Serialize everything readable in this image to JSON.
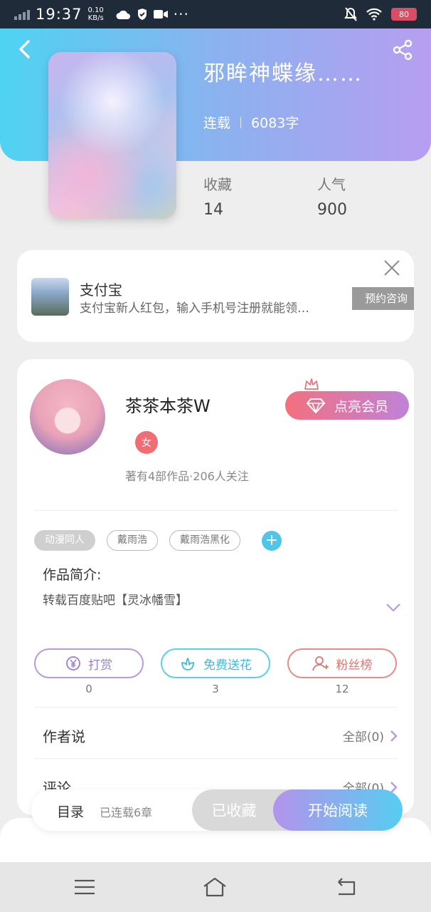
{
  "status_bar": {
    "time": "19:37",
    "net_speed_value": "0.10",
    "net_speed_unit": "KB/s",
    "more": "···",
    "battery": "80"
  },
  "header": {
    "title": "邪眸神蝶缘……",
    "status": "连载",
    "word_count": "6083字",
    "stats": {
      "collect_label": "收藏",
      "collect_value": "14",
      "popularity_label": "人气",
      "popularity_value": "900"
    }
  },
  "ad": {
    "title": "支付宝",
    "desc": "支付宝新人红包，输入手机号注册就能领…",
    "cta": "预约咨询"
  },
  "author": {
    "name": "茶茶本茶W",
    "vip_button": "点亮会员",
    "gender_badge": "女",
    "stats": "著有4部作品·206人关注"
  },
  "tags": [
    "动漫同人",
    "戴雨浩",
    "戴雨浩黑化"
  ],
  "intro": {
    "label": "作品简介:",
    "text": "转载百度贴吧【灵冰幡雪】"
  },
  "actions": [
    {
      "label": "打赏",
      "count": "0"
    },
    {
      "label": "免费送花",
      "count": "3"
    },
    {
      "label": "粉丝榜",
      "count": "12"
    }
  ],
  "rows": {
    "author_says": {
      "label": "作者说",
      "right": "全部(0)"
    },
    "comments": {
      "label": "评论",
      "right": "全部(0)"
    }
  },
  "bottom_bar": {
    "toc": "目录",
    "toc_count": "已连载6章",
    "fav": "已收藏",
    "read": "开始阅读"
  },
  "colors": {
    "header_gradient_start": "#4fd3f2",
    "header_gradient_end": "#b79ef0",
    "vip_start": "#f3707f",
    "vip_end": "#bf82d8",
    "read_start": "#b493ec",
    "read_end": "#56cdf0"
  }
}
